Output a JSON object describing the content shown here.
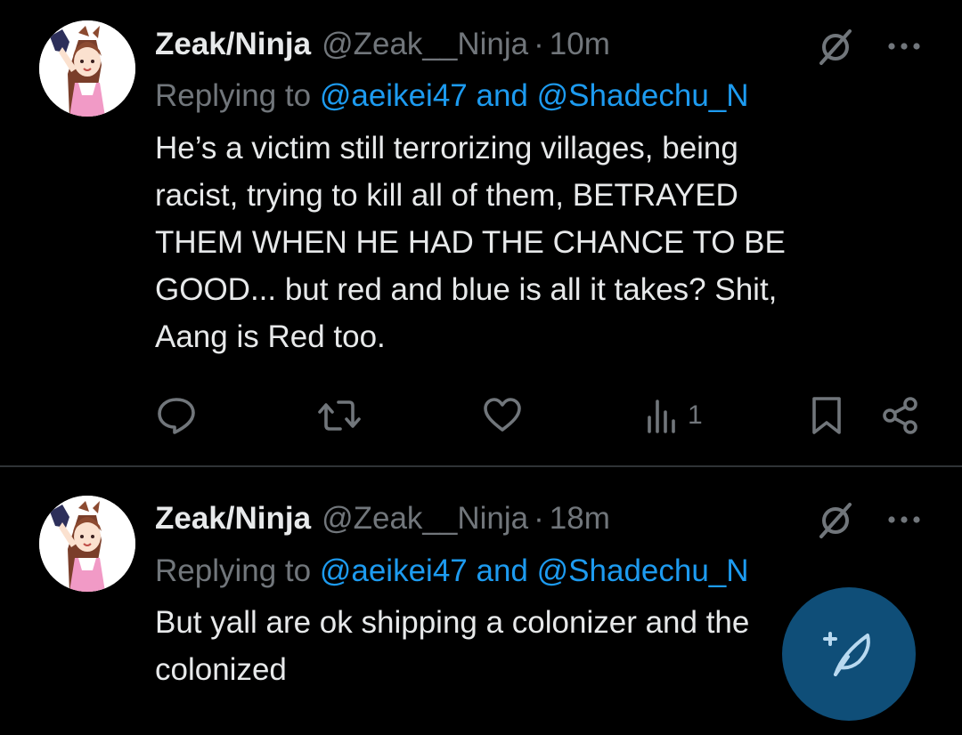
{
  "colors": {
    "background": "#000000",
    "text_primary": "#e7e9ea",
    "text_secondary": "#71767b",
    "accent": "#1d9bf0",
    "divider": "#2f3336"
  },
  "tweets": [
    {
      "display_name": "Zeak/Ninja",
      "handle": "@Zeak__Ninja",
      "separator": "·",
      "time": "10m",
      "replying_prefix": "Replying to",
      "mention_1": "@aeikei47",
      "mention_joiner": "and",
      "mention_2": "@Shadechu_N",
      "text": "He’s a victim still terrorizing villages, being\nracist, trying to kill all of them, BETRAYED\nTHEM WHEN HE HAD THE CHANCE TO BE\nGOOD... but red and blue is all it takes? Shit,\nAang is Red too.",
      "views_count": "1",
      "icons": [
        "grok-icon",
        "more-icon",
        "reply-icon",
        "retweet-icon",
        "like-icon",
        "views-icon",
        "bookmark-icon",
        "share-icon"
      ]
    },
    {
      "display_name": "Zeak/Ninja",
      "handle": "@Zeak__Ninja",
      "separator": "·",
      "time": "18m",
      "replying_prefix": "Replying to",
      "mention_1": "@aeikei47",
      "mention_joiner": "and",
      "mention_2": "@Shadechu_N",
      "text": "But yall are ok shipping a colonizer and the\ncolonized",
      "icons": [
        "grok-icon",
        "more-icon"
      ]
    }
  ],
  "compose_fab": {
    "icon": "compose-feather-icon"
  }
}
